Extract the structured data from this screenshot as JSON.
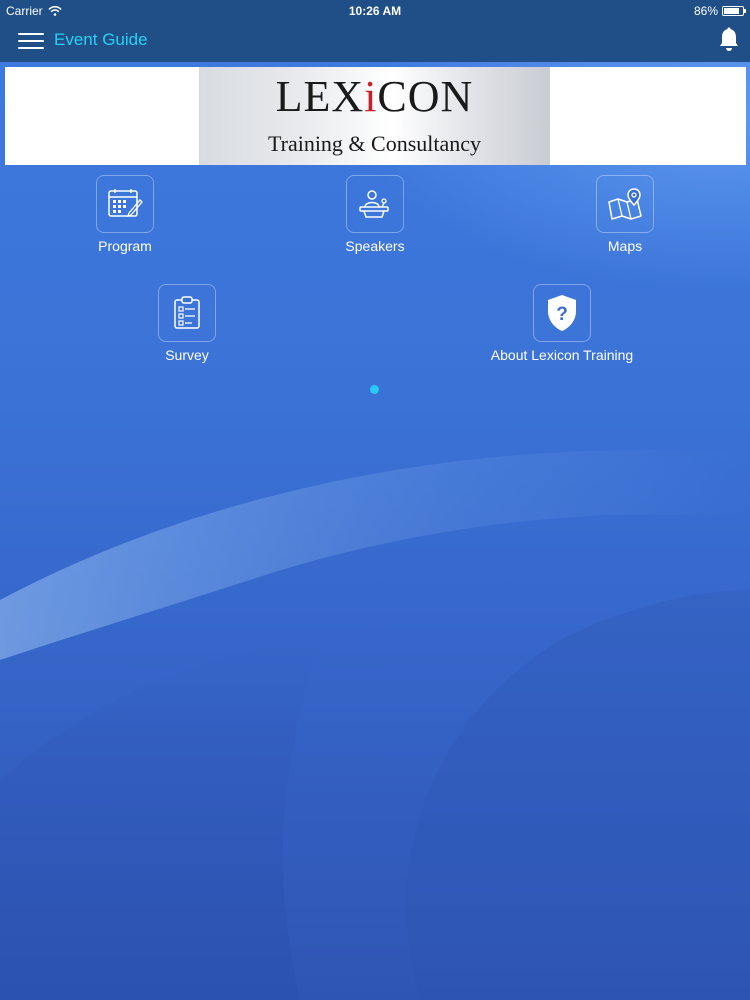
{
  "status_bar": {
    "carrier": "Carrier",
    "time": "10:26 AM",
    "battery": "86%",
    "battery_level": 0.86
  },
  "navbar": {
    "title": "Event Guide",
    "menu_icon": "hamburger-menu-icon",
    "notification_icon": "bell-icon",
    "title_color": "#29d0f2",
    "background_color": "#1f4f86"
  },
  "banner": {
    "logo_word": "LEXiCON",
    "logo_tagline": "Training & Consultancy",
    "logo_accent_color": "#c8202a"
  },
  "tiles": [
    {
      "label": "Program",
      "icon": "calendar-icon"
    },
    {
      "label": "Speakers",
      "icon": "speaker-podium-icon"
    },
    {
      "label": "Maps",
      "icon": "map-pin-icon"
    },
    {
      "label": "Survey",
      "icon": "clipboard-checklist-icon"
    },
    {
      "label": "About Lexicon Training",
      "icon": "shield-question-icon"
    }
  ],
  "pager": {
    "current_page": 1,
    "total_pages": 1,
    "dot_color": "#28c9f5"
  }
}
